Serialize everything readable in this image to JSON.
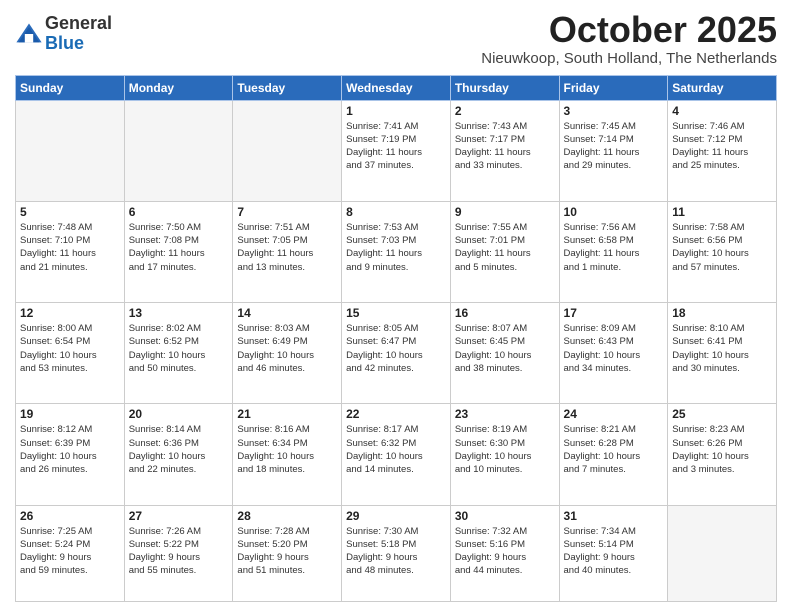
{
  "logo": {
    "general": "General",
    "blue": "Blue"
  },
  "header": {
    "month": "October 2025",
    "location": "Nieuwkoop, South Holland, The Netherlands"
  },
  "weekdays": [
    "Sunday",
    "Monday",
    "Tuesday",
    "Wednesday",
    "Thursday",
    "Friday",
    "Saturday"
  ],
  "weeks": [
    [
      {
        "day": "",
        "info": ""
      },
      {
        "day": "",
        "info": ""
      },
      {
        "day": "",
        "info": ""
      },
      {
        "day": "1",
        "info": "Sunrise: 7:41 AM\nSunset: 7:19 PM\nDaylight: 11 hours\nand 37 minutes."
      },
      {
        "day": "2",
        "info": "Sunrise: 7:43 AM\nSunset: 7:17 PM\nDaylight: 11 hours\nand 33 minutes."
      },
      {
        "day": "3",
        "info": "Sunrise: 7:45 AM\nSunset: 7:14 PM\nDaylight: 11 hours\nand 29 minutes."
      },
      {
        "day": "4",
        "info": "Sunrise: 7:46 AM\nSunset: 7:12 PM\nDaylight: 11 hours\nand 25 minutes."
      }
    ],
    [
      {
        "day": "5",
        "info": "Sunrise: 7:48 AM\nSunset: 7:10 PM\nDaylight: 11 hours\nand 21 minutes."
      },
      {
        "day": "6",
        "info": "Sunrise: 7:50 AM\nSunset: 7:08 PM\nDaylight: 11 hours\nand 17 minutes."
      },
      {
        "day": "7",
        "info": "Sunrise: 7:51 AM\nSunset: 7:05 PM\nDaylight: 11 hours\nand 13 minutes."
      },
      {
        "day": "8",
        "info": "Sunrise: 7:53 AM\nSunset: 7:03 PM\nDaylight: 11 hours\nand 9 minutes."
      },
      {
        "day": "9",
        "info": "Sunrise: 7:55 AM\nSunset: 7:01 PM\nDaylight: 11 hours\nand 5 minutes."
      },
      {
        "day": "10",
        "info": "Sunrise: 7:56 AM\nSunset: 6:58 PM\nDaylight: 11 hours\nand 1 minute."
      },
      {
        "day": "11",
        "info": "Sunrise: 7:58 AM\nSunset: 6:56 PM\nDaylight: 10 hours\nand 57 minutes."
      }
    ],
    [
      {
        "day": "12",
        "info": "Sunrise: 8:00 AM\nSunset: 6:54 PM\nDaylight: 10 hours\nand 53 minutes."
      },
      {
        "day": "13",
        "info": "Sunrise: 8:02 AM\nSunset: 6:52 PM\nDaylight: 10 hours\nand 50 minutes."
      },
      {
        "day": "14",
        "info": "Sunrise: 8:03 AM\nSunset: 6:49 PM\nDaylight: 10 hours\nand 46 minutes."
      },
      {
        "day": "15",
        "info": "Sunrise: 8:05 AM\nSunset: 6:47 PM\nDaylight: 10 hours\nand 42 minutes."
      },
      {
        "day": "16",
        "info": "Sunrise: 8:07 AM\nSunset: 6:45 PM\nDaylight: 10 hours\nand 38 minutes."
      },
      {
        "day": "17",
        "info": "Sunrise: 8:09 AM\nSunset: 6:43 PM\nDaylight: 10 hours\nand 34 minutes."
      },
      {
        "day": "18",
        "info": "Sunrise: 8:10 AM\nSunset: 6:41 PM\nDaylight: 10 hours\nand 30 minutes."
      }
    ],
    [
      {
        "day": "19",
        "info": "Sunrise: 8:12 AM\nSunset: 6:39 PM\nDaylight: 10 hours\nand 26 minutes."
      },
      {
        "day": "20",
        "info": "Sunrise: 8:14 AM\nSunset: 6:36 PM\nDaylight: 10 hours\nand 22 minutes."
      },
      {
        "day": "21",
        "info": "Sunrise: 8:16 AM\nSunset: 6:34 PM\nDaylight: 10 hours\nand 18 minutes."
      },
      {
        "day": "22",
        "info": "Sunrise: 8:17 AM\nSunset: 6:32 PM\nDaylight: 10 hours\nand 14 minutes."
      },
      {
        "day": "23",
        "info": "Sunrise: 8:19 AM\nSunset: 6:30 PM\nDaylight: 10 hours\nand 10 minutes."
      },
      {
        "day": "24",
        "info": "Sunrise: 8:21 AM\nSunset: 6:28 PM\nDaylight: 10 hours\nand 7 minutes."
      },
      {
        "day": "25",
        "info": "Sunrise: 8:23 AM\nSunset: 6:26 PM\nDaylight: 10 hours\nand 3 minutes."
      }
    ],
    [
      {
        "day": "26",
        "info": "Sunrise: 7:25 AM\nSunset: 5:24 PM\nDaylight: 9 hours\nand 59 minutes."
      },
      {
        "day": "27",
        "info": "Sunrise: 7:26 AM\nSunset: 5:22 PM\nDaylight: 9 hours\nand 55 minutes."
      },
      {
        "day": "28",
        "info": "Sunrise: 7:28 AM\nSunset: 5:20 PM\nDaylight: 9 hours\nand 51 minutes."
      },
      {
        "day": "29",
        "info": "Sunrise: 7:30 AM\nSunset: 5:18 PM\nDaylight: 9 hours\nand 48 minutes."
      },
      {
        "day": "30",
        "info": "Sunrise: 7:32 AM\nSunset: 5:16 PM\nDaylight: 9 hours\nand 44 minutes."
      },
      {
        "day": "31",
        "info": "Sunrise: 7:34 AM\nSunset: 5:14 PM\nDaylight: 9 hours\nand 40 minutes."
      },
      {
        "day": "",
        "info": ""
      }
    ]
  ]
}
